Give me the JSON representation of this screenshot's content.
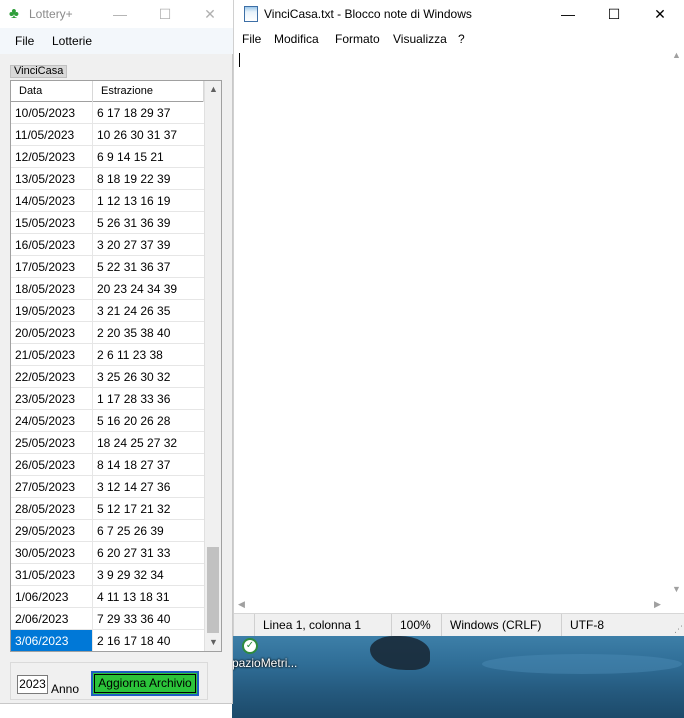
{
  "lottery_window": {
    "title": "Lottery+",
    "controls": {
      "minimize": "—",
      "maximize": "☐",
      "close": "✕"
    },
    "menu": [
      "File",
      "Lotterie"
    ],
    "tab": "VinciCasa",
    "columns": {
      "date": "Data",
      "draw": "Estrazione"
    },
    "rows": [
      {
        "date": "10/05/2023",
        "draw": "6 17 18 29 37"
      },
      {
        "date": "11/05/2023",
        "draw": "10 26 30 31 37"
      },
      {
        "date": "12/05/2023",
        "draw": "6 9 14 15 21"
      },
      {
        "date": "13/05/2023",
        "draw": "8 18 19 22 39"
      },
      {
        "date": "14/05/2023",
        "draw": "1 12 13 16 19"
      },
      {
        "date": "15/05/2023",
        "draw": "5 26 31 36 39"
      },
      {
        "date": "16/05/2023",
        "draw": "3 20 27 37 39"
      },
      {
        "date": "17/05/2023",
        "draw": "5 22 31 36 37"
      },
      {
        "date": "18/05/2023",
        "draw": "20 23 24 34 39"
      },
      {
        "date": "19/05/2023",
        "draw": "3 21 24 26 35"
      },
      {
        "date": "20/05/2023",
        "draw": "2 20 35 38 40"
      },
      {
        "date": "21/05/2023",
        "draw": "2 6 11 23 38"
      },
      {
        "date": "22/05/2023",
        "draw": "3 25 26 30 32"
      },
      {
        "date": "23/05/2023",
        "draw": "1 17 28 33 36"
      },
      {
        "date": "24/05/2023",
        "draw": "5 16 20 26 28"
      },
      {
        "date": "25/05/2023",
        "draw": "18 24 25 27 32"
      },
      {
        "date": "26/05/2023",
        "draw": "8 14 18 27 37"
      },
      {
        "date": "27/05/2023",
        "draw": "3 12 14 27 36"
      },
      {
        "date": "28/05/2023",
        "draw": "5 12 17 21 32"
      },
      {
        "date": "29/05/2023",
        "draw": "6 7 25 26 39"
      },
      {
        "date": "30/05/2023",
        "draw": "6 20 27 31 33"
      },
      {
        "date": "31/05/2023",
        "draw": "3 9 29 32 34"
      },
      {
        "date": "1/06/2023",
        "draw": "4 11 13 18 31"
      },
      {
        "date": "2/06/2023",
        "draw": "7 29 33 36 40"
      },
      {
        "date": "3/06/2023",
        "draw": "2 16 17 18 40"
      }
    ],
    "selected_row": 24,
    "year_value": "2023",
    "year_label": "Anno",
    "update_button": "Aggiorna Archivio"
  },
  "notepad_window": {
    "title": "VinciCasa.txt - Blocco note di Windows",
    "controls": {
      "minimize": "—",
      "maximize": "☐",
      "close": "✕"
    },
    "menu": [
      "File",
      "Modifica",
      "Formato",
      "Visualizza",
      "?"
    ],
    "content": "",
    "status": {
      "position": "Linea 1, colonna 1",
      "zoom": "100%",
      "line_endings": "Windows (CRLF)",
      "encoding": "UTF-8"
    }
  },
  "desktop": {
    "icon_label": "pazioMetri..."
  },
  "colors": {
    "selection": "#0078d7",
    "button_green": "#2bc43a",
    "button_border": "#1f5ec2"
  }
}
